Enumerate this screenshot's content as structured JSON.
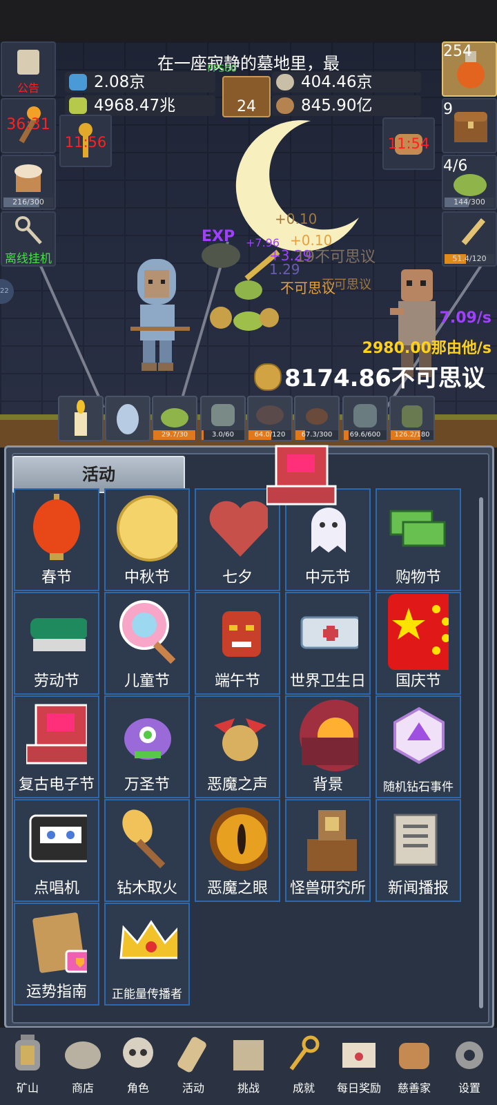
{
  "story_text": "在一座寂静的墓地里，最",
  "fps": "FPS60",
  "resources": {
    "potion_blue": "2.08京",
    "coin_silver": "404.46京",
    "potion_green": "4968.47兆",
    "seed": "845.90亿",
    "book_count": "24"
  },
  "left_buttons": {
    "notice_label": "公告",
    "torch_timer": "36:31",
    "cake_progress": "216/300",
    "cake_progress_value": 0.72,
    "offline_label": "离线挂机",
    "key_timer": "11:56",
    "side_tab": "22"
  },
  "right_buttons": {
    "potion_count": "254",
    "chest_count": "9",
    "slime_count": "4/6",
    "slime_progress": "144/300",
    "slime_progress_value": 0.48,
    "sword_progress": "51.4/120",
    "sword_progress_value": 0.43,
    "bread_timer": "11:54"
  },
  "floating_texts": [
    "+0.10",
    "+0.10",
    "+7.96",
    "+3.29",
    "1.29",
    "19不可思议",
    "不可思议",
    "不可思议"
  ],
  "stats": {
    "rate_purple": "7.09/s",
    "rate_gold": "2980.00那由他/s",
    "total_coins": "8174.86不可思议"
  },
  "slots": [
    {
      "name": "candle",
      "cap": ""
    },
    {
      "name": "egg",
      "cap": ""
    },
    {
      "name": "slime",
      "cap": "29.7/30",
      "value": 0.99
    },
    {
      "name": "zombie-head",
      "cap": "3.0/60",
      "value": 0.05
    },
    {
      "name": "bat",
      "cap": "64.0/120",
      "value": 0.53
    },
    {
      "name": "spider",
      "cap": "67.3/300",
      "value": 0.22
    },
    {
      "name": "ghoul",
      "cap": "69.6/600",
      "value": 0.12
    },
    {
      "name": "goblin",
      "cap": "126.2/180",
      "value": 0.7
    }
  ],
  "panel_title": "活动",
  "events": [
    {
      "name": "春节",
      "icon": "lantern"
    },
    {
      "name": "中秋节",
      "icon": "moon"
    },
    {
      "name": "七夕",
      "icon": "heart"
    },
    {
      "name": "中元节",
      "icon": "ghost"
    },
    {
      "name": "购物节",
      "icon": "cash"
    },
    {
      "name": "劳动节",
      "icon": "brush"
    },
    {
      "name": "儿童节",
      "icon": "lollipop"
    },
    {
      "name": "端午节",
      "icon": "mask"
    },
    {
      "name": "世界卫生日",
      "icon": "ambulance"
    },
    {
      "name": "国庆节",
      "icon": "flag"
    },
    {
      "name": "复古电子节",
      "icon": "computer"
    },
    {
      "name": "万圣节",
      "icon": "monster"
    },
    {
      "name": "恶魔之声",
      "icon": "bell"
    },
    {
      "name": "背景",
      "icon": "sunset"
    },
    {
      "name": "随机钻石事件",
      "icon": "diamond"
    },
    {
      "name": "点唱机",
      "icon": "cassette"
    },
    {
      "name": "钻木取火",
      "icon": "torch"
    },
    {
      "name": "恶魔之眼",
      "icon": "eye"
    },
    {
      "name": "怪兽研究所",
      "icon": "lab"
    },
    {
      "name": "新闻播报",
      "icon": "news"
    },
    {
      "name": "运势指南",
      "icon": "map"
    },
    {
      "name": "正能量传播者",
      "icon": "crown"
    }
  ],
  "nav": [
    {
      "label": "矿山",
      "icon": "lantern"
    },
    {
      "label": "商店",
      "icon": "stone"
    },
    {
      "label": "角色",
      "icon": "skull"
    },
    {
      "label": "活动",
      "icon": "scroll"
    },
    {
      "label": "挑战",
      "icon": "map"
    },
    {
      "label": "成就",
      "icon": "key"
    },
    {
      "label": "每日奖励",
      "icon": "envelope"
    },
    {
      "label": "慈善家",
      "icon": "bread"
    },
    {
      "label": "设置",
      "icon": "gear"
    }
  ],
  "colors": {
    "accent_blue": "#2b6ab0",
    "timer_red": "#ff2020",
    "gold_text": "#ffd21a",
    "purple_text": "#a040ff",
    "green_text": "#45e045"
  }
}
